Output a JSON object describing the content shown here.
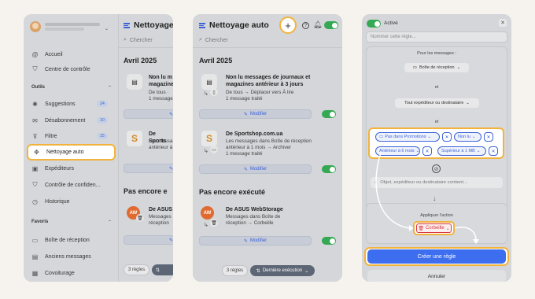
{
  "panel1": {
    "sidebar": {
      "nav_top": [
        {
          "label": "Accueil",
          "icon": "at-icon"
        },
        {
          "label": "Centre de contrôle",
          "icon": "shield-icon"
        }
      ],
      "tools_section": "Outils",
      "tools": [
        {
          "label": "Suggestions",
          "icon": "lightbulb-icon",
          "count": "24"
        },
        {
          "label": "Désabonnement",
          "icon": "unsubscribe-icon",
          "count": "10"
        },
        {
          "label": "Filtre",
          "icon": "filter-icon",
          "count": "15"
        },
        {
          "label": "Nettoyage auto",
          "icon": "broom-icon"
        },
        {
          "label": "Expéditeurs",
          "icon": "senders-icon"
        },
        {
          "label": "Contrôle de confiden...",
          "icon": "lock-shield-icon"
        },
        {
          "label": "Historique",
          "icon": "history-icon"
        }
      ],
      "favorites_section": "Favoris",
      "favorites": [
        {
          "label": "Boîte de réception",
          "icon": "inbox-icon"
        },
        {
          "label": "Anciens messages",
          "icon": "archive-icon"
        },
        {
          "label": "Covoiturage",
          "icon": "car-icon"
        }
      ]
    },
    "content": {
      "title": "Nettoyage",
      "search_placeholder": "Chercher",
      "month": "Avril 2025",
      "items": [
        {
          "title": "Non lu m magazines",
          "line1": "De tous ·",
          "line2": "1 message"
        },
        {
          "title": "De Sports",
          "line1": "Les messa",
          "line2": "antérieur à"
        }
      ],
      "section2": "Pas encore e",
      "items2": [
        {
          "avatar": "AW",
          "title": "De ASUS",
          "line1": "Messages",
          "line2": "réception"
        }
      ],
      "footer_count": "3 règles"
    }
  },
  "panel2": {
    "title": "Nettoyage auto",
    "search_placeholder": "Chercher",
    "month": "Avril 2025",
    "items": [
      {
        "title": "Non lu messages de journaux et magazines antérieur à 3 jours",
        "line1": "De tous → Déplacer vers À lire",
        "line2": "1 message traité",
        "modify": "Modifier"
      },
      {
        "title": "De Sportshop.com.ua",
        "line1": "Les messages dans Boîte de réception",
        "line2": "antérieur à 1 mois → Archiver",
        "line3": "1 message traité",
        "modify": "Modifier"
      }
    ],
    "section2": "Pas encore exécuté",
    "items2": [
      {
        "avatar": "AW",
        "title": "De ASUS WebStorage",
        "line1": "Messages dans Boîte de",
        "line2": "réception → Corbeille",
        "modify": "Modifier"
      }
    ],
    "footer_count": "3 règles",
    "footer_sort": "Dernière exécution"
  },
  "panel3": {
    "active_label": "Activé",
    "name_placeholder": "Nommer cette règle...",
    "for_messages": "Pour les messages :",
    "folder_select": "Boîte de réception",
    "and1": "et",
    "sender_select": "Tout expéditeur ou destinataire",
    "and2": "et",
    "chips": [
      {
        "label": "Pas dans Promotions"
      },
      {
        "label": "Non lu"
      },
      {
        "label": "Antérieur à 6 mois"
      },
      {
        "label": "Supérieur à 1 MB"
      }
    ],
    "search_placeholder": "Objet, expéditeur ou destinataire contient...",
    "apply_action": "Appliquer l'action",
    "action": "Corbeille",
    "create": "Créer une règle",
    "cancel": "Annuler"
  }
}
